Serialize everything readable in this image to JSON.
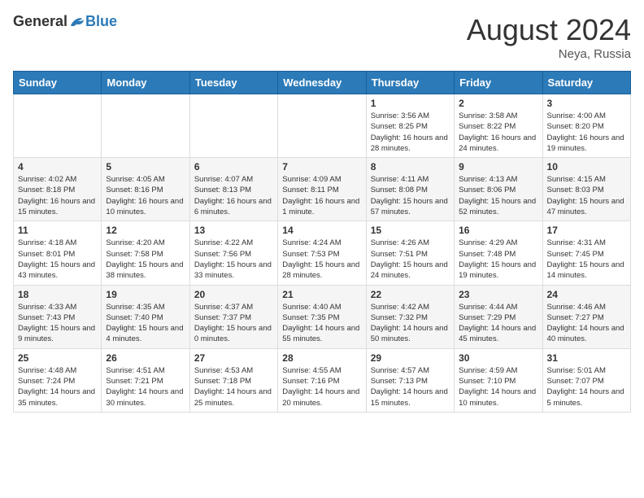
{
  "header": {
    "logo_general": "General",
    "logo_blue": "Blue",
    "month_year": "August 2024",
    "location": "Neya, Russia"
  },
  "weekdays": [
    "Sunday",
    "Monday",
    "Tuesday",
    "Wednesday",
    "Thursday",
    "Friday",
    "Saturday"
  ],
  "weeks": [
    [
      {
        "date": "",
        "info": ""
      },
      {
        "date": "",
        "info": ""
      },
      {
        "date": "",
        "info": ""
      },
      {
        "date": "",
        "info": ""
      },
      {
        "date": "1",
        "info": "Sunrise: 3:56 AM\nSunset: 8:25 PM\nDaylight: 16 hours and 28 minutes."
      },
      {
        "date": "2",
        "info": "Sunrise: 3:58 AM\nSunset: 8:22 PM\nDaylight: 16 hours and 24 minutes."
      },
      {
        "date": "3",
        "info": "Sunrise: 4:00 AM\nSunset: 8:20 PM\nDaylight: 16 hours and 19 minutes."
      }
    ],
    [
      {
        "date": "4",
        "info": "Sunrise: 4:02 AM\nSunset: 8:18 PM\nDaylight: 16 hours and 15 minutes."
      },
      {
        "date": "5",
        "info": "Sunrise: 4:05 AM\nSunset: 8:16 PM\nDaylight: 16 hours and 10 minutes."
      },
      {
        "date": "6",
        "info": "Sunrise: 4:07 AM\nSunset: 8:13 PM\nDaylight: 16 hours and 6 minutes."
      },
      {
        "date": "7",
        "info": "Sunrise: 4:09 AM\nSunset: 8:11 PM\nDaylight: 16 hours and 1 minute."
      },
      {
        "date": "8",
        "info": "Sunrise: 4:11 AM\nSunset: 8:08 PM\nDaylight: 15 hours and 57 minutes."
      },
      {
        "date": "9",
        "info": "Sunrise: 4:13 AM\nSunset: 8:06 PM\nDaylight: 15 hours and 52 minutes."
      },
      {
        "date": "10",
        "info": "Sunrise: 4:15 AM\nSunset: 8:03 PM\nDaylight: 15 hours and 47 minutes."
      }
    ],
    [
      {
        "date": "11",
        "info": "Sunrise: 4:18 AM\nSunset: 8:01 PM\nDaylight: 15 hours and 43 minutes."
      },
      {
        "date": "12",
        "info": "Sunrise: 4:20 AM\nSunset: 7:58 PM\nDaylight: 15 hours and 38 minutes."
      },
      {
        "date": "13",
        "info": "Sunrise: 4:22 AM\nSunset: 7:56 PM\nDaylight: 15 hours and 33 minutes."
      },
      {
        "date": "14",
        "info": "Sunrise: 4:24 AM\nSunset: 7:53 PM\nDaylight: 15 hours and 28 minutes."
      },
      {
        "date": "15",
        "info": "Sunrise: 4:26 AM\nSunset: 7:51 PM\nDaylight: 15 hours and 24 minutes."
      },
      {
        "date": "16",
        "info": "Sunrise: 4:29 AM\nSunset: 7:48 PM\nDaylight: 15 hours and 19 minutes."
      },
      {
        "date": "17",
        "info": "Sunrise: 4:31 AM\nSunset: 7:45 PM\nDaylight: 15 hours and 14 minutes."
      }
    ],
    [
      {
        "date": "18",
        "info": "Sunrise: 4:33 AM\nSunset: 7:43 PM\nDaylight: 15 hours and 9 minutes."
      },
      {
        "date": "19",
        "info": "Sunrise: 4:35 AM\nSunset: 7:40 PM\nDaylight: 15 hours and 4 minutes."
      },
      {
        "date": "20",
        "info": "Sunrise: 4:37 AM\nSunset: 7:37 PM\nDaylight: 15 hours and 0 minutes."
      },
      {
        "date": "21",
        "info": "Sunrise: 4:40 AM\nSunset: 7:35 PM\nDaylight: 14 hours and 55 minutes."
      },
      {
        "date": "22",
        "info": "Sunrise: 4:42 AM\nSunset: 7:32 PM\nDaylight: 14 hours and 50 minutes."
      },
      {
        "date": "23",
        "info": "Sunrise: 4:44 AM\nSunset: 7:29 PM\nDaylight: 14 hours and 45 minutes."
      },
      {
        "date": "24",
        "info": "Sunrise: 4:46 AM\nSunset: 7:27 PM\nDaylight: 14 hours and 40 minutes."
      }
    ],
    [
      {
        "date": "25",
        "info": "Sunrise: 4:48 AM\nSunset: 7:24 PM\nDaylight: 14 hours and 35 minutes."
      },
      {
        "date": "26",
        "info": "Sunrise: 4:51 AM\nSunset: 7:21 PM\nDaylight: 14 hours and 30 minutes."
      },
      {
        "date": "27",
        "info": "Sunrise: 4:53 AM\nSunset: 7:18 PM\nDaylight: 14 hours and 25 minutes."
      },
      {
        "date": "28",
        "info": "Sunrise: 4:55 AM\nSunset: 7:16 PM\nDaylight: 14 hours and 20 minutes."
      },
      {
        "date": "29",
        "info": "Sunrise: 4:57 AM\nSunset: 7:13 PM\nDaylight: 14 hours and 15 minutes."
      },
      {
        "date": "30",
        "info": "Sunrise: 4:59 AM\nSunset: 7:10 PM\nDaylight: 14 hours and 10 minutes."
      },
      {
        "date": "31",
        "info": "Sunrise: 5:01 AM\nSunset: 7:07 PM\nDaylight: 14 hours and 5 minutes."
      }
    ]
  ]
}
